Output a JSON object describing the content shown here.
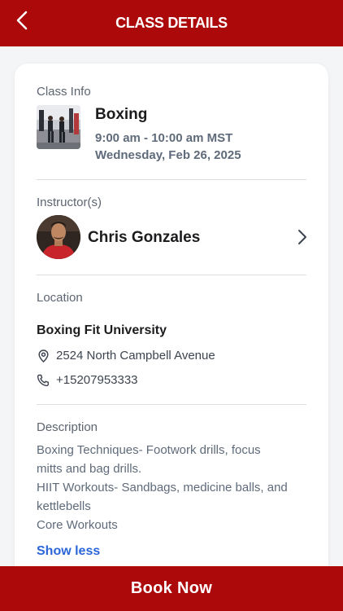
{
  "header": {
    "title": "CLASS DETAILS",
    "back_icon": "chevron-left-icon"
  },
  "class_info": {
    "section_label": "Class Info",
    "name": "Boxing",
    "time": "9:00 am - 10:00 am MST",
    "date": "Wednesday, Feb 26, 2025"
  },
  "instructors": {
    "section_label": "Instructor(s)",
    "name": "Chris Gonzales"
  },
  "location": {
    "section_label": "Location",
    "name": "Boxing Fit University",
    "address": "2524 North Campbell Avenue",
    "phone": "+15207953333"
  },
  "description": {
    "section_label": "Description",
    "text": "Boxing Techniques- Footwork drills, focus\nmitts and bag drills.\nHIIT Workouts- Sandbags, medicine balls, and\nkettlebells\nCore Workouts",
    "toggle_label": "Show less"
  },
  "footer": {
    "book_label": "Book Now"
  },
  "colors": {
    "brand_red": "#ac0a0a",
    "link_blue": "#2b66d9"
  }
}
